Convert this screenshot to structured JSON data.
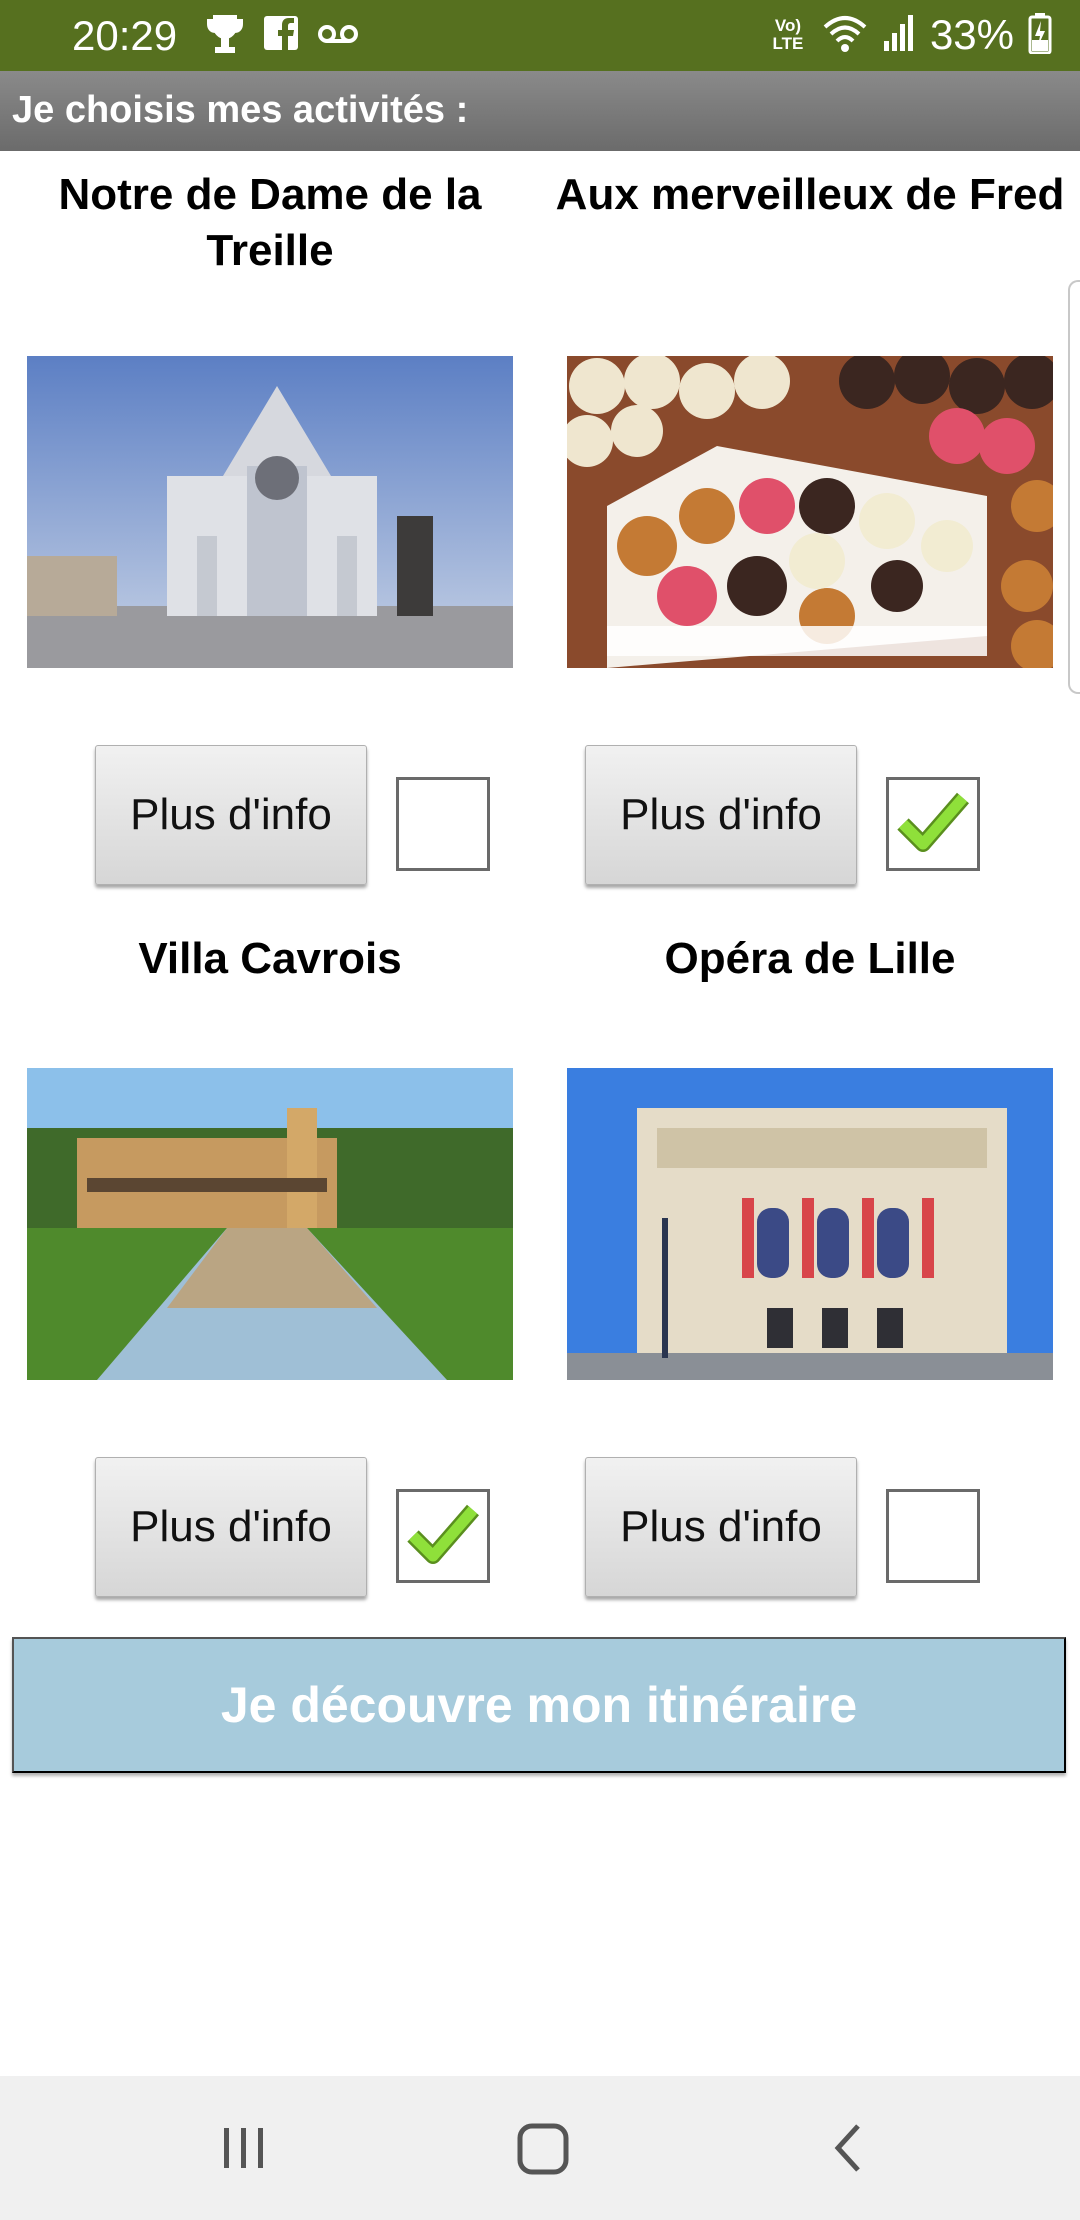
{
  "status_bar": {
    "time": "20:29",
    "battery": "33%",
    "network": "Vo) LTE",
    "icons": [
      "trophy-icon",
      "facebook-icon",
      "voicemail-icon",
      "volte-icon",
      "wifi-icon",
      "signal-icon",
      "battery-charging-icon"
    ]
  },
  "header": {
    "title": "Je choisis mes activités :"
  },
  "activities": [
    {
      "name": "Notre de Dame de la Treille",
      "info_label": "Plus d'info",
      "checked": false,
      "photo": "cathedral-photo"
    },
    {
      "name": "Aux merveilleux de Fred",
      "info_label": "Plus d'info",
      "checked": true,
      "photo": "pastries-photo"
    },
    {
      "name": "Villa Cavrois",
      "info_label": "Plus d'info",
      "checked": true,
      "photo": "villa-photo"
    },
    {
      "name": "Opéra de Lille",
      "info_label": "Plus d'info",
      "checked": false,
      "photo": "opera-photo"
    }
  ],
  "main_button": {
    "label": "Je découvre mon itinéraire"
  },
  "navigation": [
    "recent-apps-icon",
    "home-icon",
    "back-icon"
  ],
  "colors": {
    "status_bar": "#56701f",
    "title_bar": "#787878",
    "main_button": "#a7cbdc",
    "check": "#7ed321"
  }
}
